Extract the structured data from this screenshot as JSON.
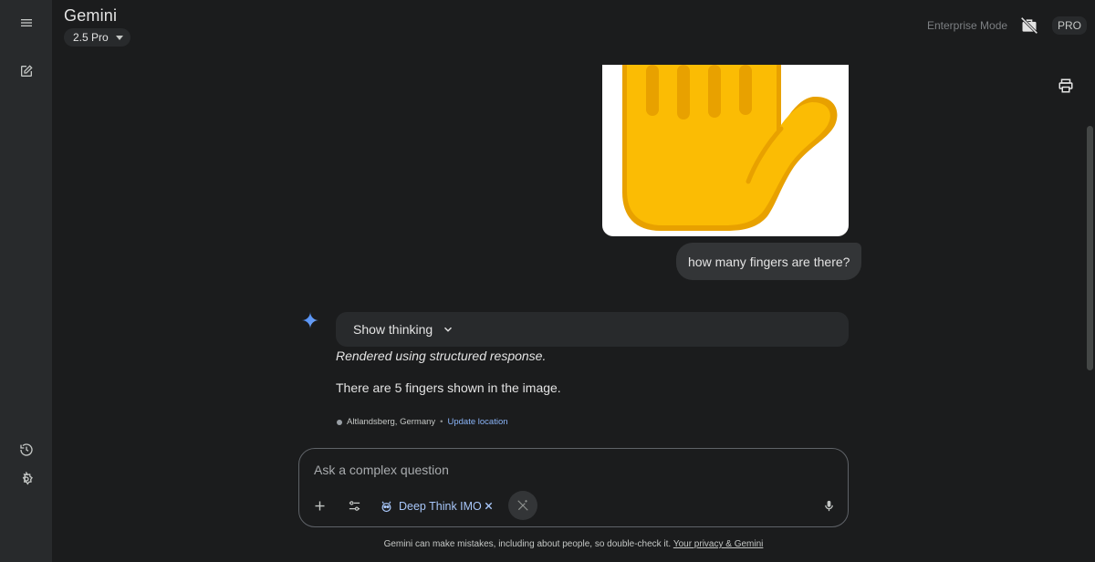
{
  "header": {
    "app_title": "Gemini",
    "model_label": "2.5 Pro",
    "enterprise_label": "Enterprise Mode",
    "pro_badge": "PRO"
  },
  "rail": {
    "icons": [
      "menu-icon",
      "new-chat-icon",
      "history-icon",
      "settings-icon"
    ]
  },
  "conversation": {
    "user_message": "how many fingers are there?",
    "thinking_label": "Show thinking",
    "italic_note": "Rendered using structured response.",
    "answer": "There are 5 fingers shown in the image.",
    "location": {
      "place": "Altlandsberg, Germany",
      "separator": "•",
      "update_link": "Update location"
    }
  },
  "composer": {
    "placeholder": "Ask a complex question",
    "tool_chip": "Deep Think IMO"
  },
  "footer": {
    "disclaimer": "Gemini can make mistakes, including about people, so double-check it.",
    "link": "Your privacy & Gemini"
  },
  "colors": {
    "background": "#1b1c1d",
    "rail": "#282a2c",
    "accent": "#a8c7fa",
    "link": "#8ab4f8",
    "hand_fill": "#fbbc04",
    "hand_shadow": "#e8a100"
  }
}
